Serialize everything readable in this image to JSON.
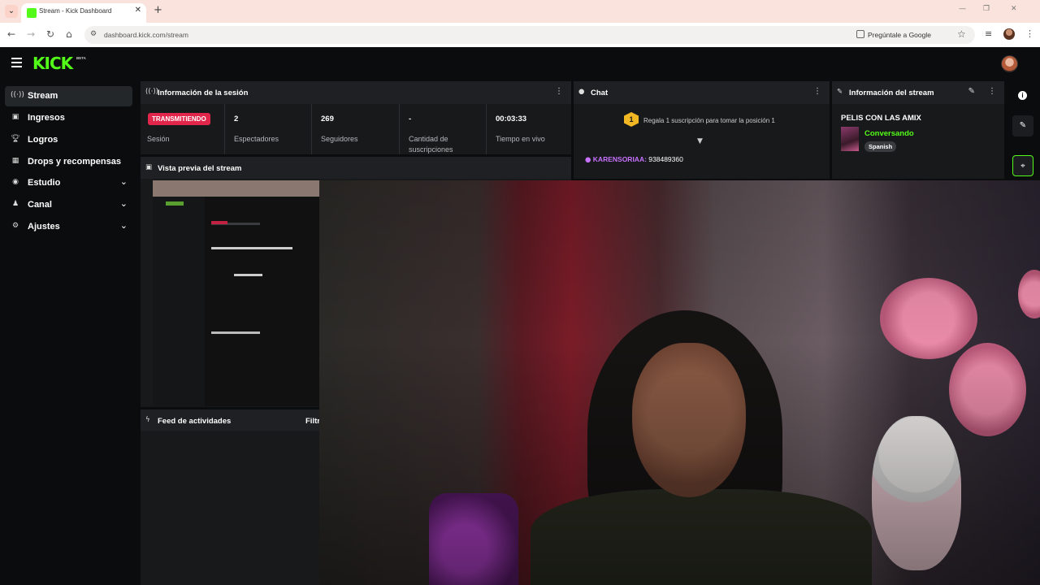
{
  "browser": {
    "tab_title": "Stream - Kick Dashboard",
    "url": "dashboard.kick.com/stream",
    "ask_google": "Pregúntale a Google"
  },
  "header": {
    "logo": "KICK",
    "beta": "BETA"
  },
  "sidebar": {
    "items": [
      {
        "label": "Stream",
        "icon": "broadcast-icon"
      },
      {
        "label": "Ingresos",
        "icon": "wallet-icon"
      },
      {
        "label": "Logros",
        "icon": "trophy-icon"
      },
      {
        "label": "Drops y recompensas",
        "icon": "gift-icon"
      },
      {
        "label": "Estudio",
        "icon": "studio-icon"
      },
      {
        "label": "Canal",
        "icon": "users-icon"
      },
      {
        "label": "Ajustes",
        "icon": "gear-icon"
      }
    ]
  },
  "session": {
    "title": "Información de la sesión",
    "status_badge": "TRANSMITIENDO",
    "status_label": "Sesión",
    "viewers_value": "2",
    "viewers_label": "Espectadores",
    "followers_value": "269",
    "followers_label": "Seguidores",
    "subs_value": "-",
    "subs_label": "Cantidad de suscripciones",
    "time_value": "00:03:33",
    "time_label": "Tiempo en vivo"
  },
  "chat": {
    "title": "Chat",
    "sub_badge": "1",
    "sub_text": "Regala 1 suscripción para tomar la posición 1",
    "message_user": "KARENSORIAA:",
    "message_text": " 938489360"
  },
  "stream_info": {
    "title": "Información del stream",
    "stream_title": "PELIS CON LAS AMIX",
    "category": "Conversando",
    "tag": "Spanish"
  },
  "preview": {
    "title": "Vista previa del stream"
  },
  "feed": {
    "title": "Feed de actividades",
    "filter": "Filtr"
  },
  "colors": {
    "brand": "#53fc18",
    "live": "#e2264b",
    "chat_user": "#c672ff"
  }
}
